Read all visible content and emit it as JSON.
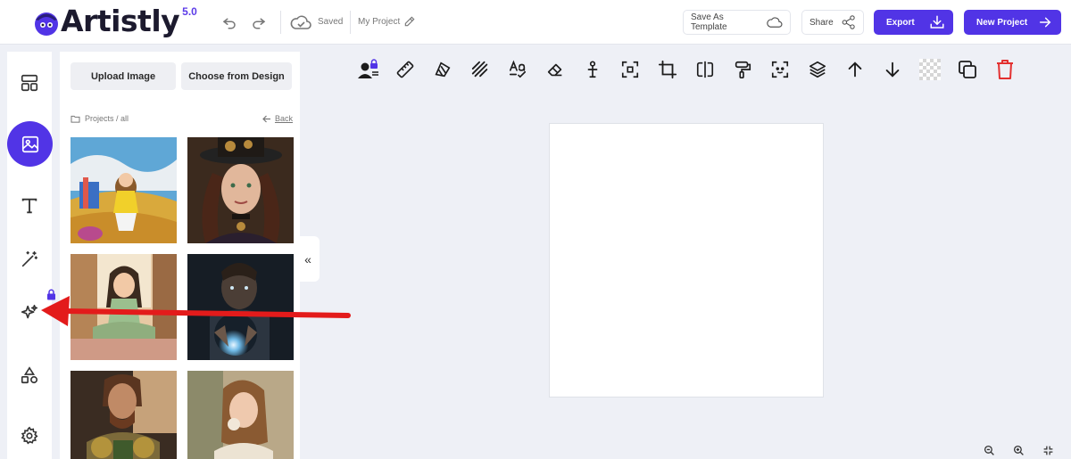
{
  "header": {
    "logo_text": "Artistly",
    "logo_version": "5.0",
    "save_status": "Saved",
    "project_name": "My Project",
    "save_as_template": "Save As Template",
    "share": "Share",
    "export": "Export",
    "new_project": "New Project"
  },
  "rail": {
    "items": [
      "layout-icon",
      "image-icon",
      "text-icon",
      "magic-wand-icon",
      "sparkles-icon",
      "shapes-icon",
      "settings-icon"
    ],
    "active": "image-icon"
  },
  "panel": {
    "upload_label": "Upload Image",
    "choose_label": "Choose from Design",
    "breadcrumb": "Projects / all",
    "back_label": "Back",
    "collapse_glyph": "«"
  },
  "toolbar": {
    "tools": [
      "person-lock-icon",
      "ruler-icon",
      "opacity-icon",
      "stripes-icon",
      "text-style-icon",
      "eraser-icon",
      "pin-icon",
      "selection-icon",
      "crop-icon",
      "flip-icon",
      "paint-roller-icon",
      "focus-icon",
      "layers-icon",
      "arrow-up-icon",
      "arrow-down-icon",
      "transparency-icon",
      "duplicate-icon",
      "trash-icon"
    ]
  },
  "zoom": [
    "zoom-out-icon",
    "zoom-in-icon",
    "fit-screen-icon"
  ],
  "colors": {
    "accent": "#5134e6",
    "annotation_arrow": "#e31b1b",
    "delete": "#e33030"
  }
}
